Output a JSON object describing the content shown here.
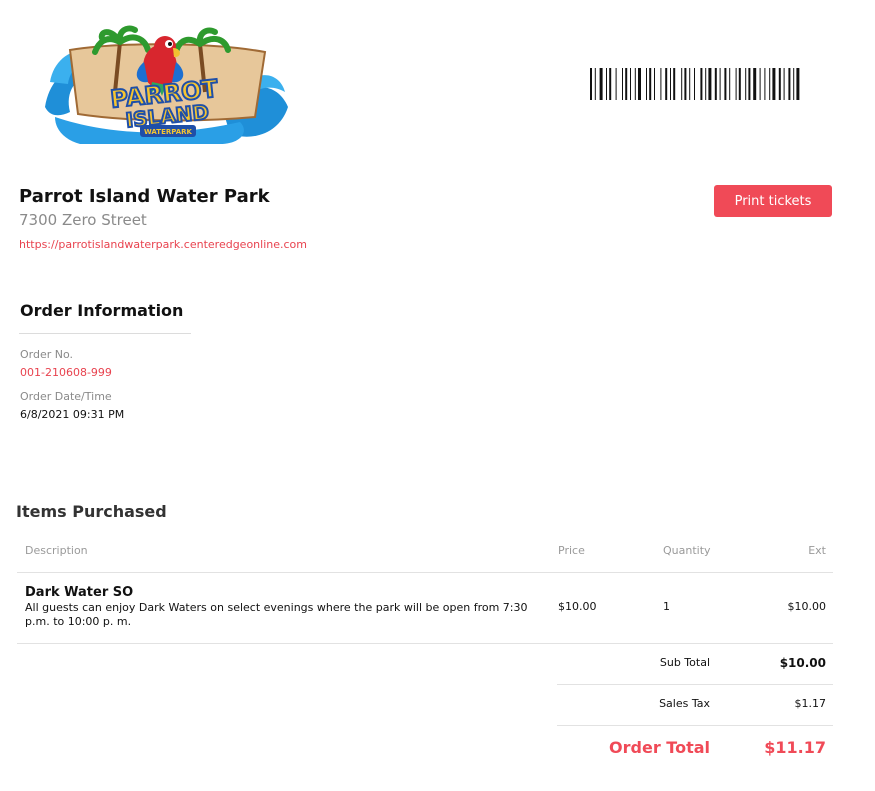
{
  "header": {
    "logo": {
      "icon": "parrot-island-logo",
      "line1": "PARROT",
      "line2": "ISLAND",
      "line3": "WATERPARK"
    },
    "barcode": {
      "icon": "barcode-icon"
    }
  },
  "venue": {
    "name": "Parrot Island Water Park",
    "address": "7300 Zero Street",
    "url": "https://parrotislandwaterpark.centeredgeonline.com"
  },
  "actions": {
    "print_label": "Print tickets"
  },
  "order": {
    "heading": "Order Information",
    "number_label": "Order No.",
    "number_value": "001-210608-999",
    "datetime_label": "Order Date/Time",
    "datetime_value": "6/8/2021 09:31 PM"
  },
  "items": {
    "heading": "Items Purchased",
    "columns": [
      "Description",
      "Price",
      "Quantity",
      "Ext"
    ],
    "rows": [
      {
        "name": "Dark Water SO",
        "description": "All guests can enjoy Dark Waters on select evenings where the park will be open from 7:30 p.m. to 10:00 p. m.",
        "price": "$10.00",
        "quantity": "1",
        "ext": "$10.00"
      }
    ]
  },
  "totals": {
    "subtotal_label": "Sub Total",
    "subtotal_value": "$10.00",
    "tax_label": "Sales Tax",
    "tax_value": "$1.17",
    "total_label": "Order Total",
    "total_value": "$11.17"
  },
  "colors": {
    "accent": "#f04a57",
    "link": "#e8434f",
    "muted": "#8a8a8a"
  }
}
